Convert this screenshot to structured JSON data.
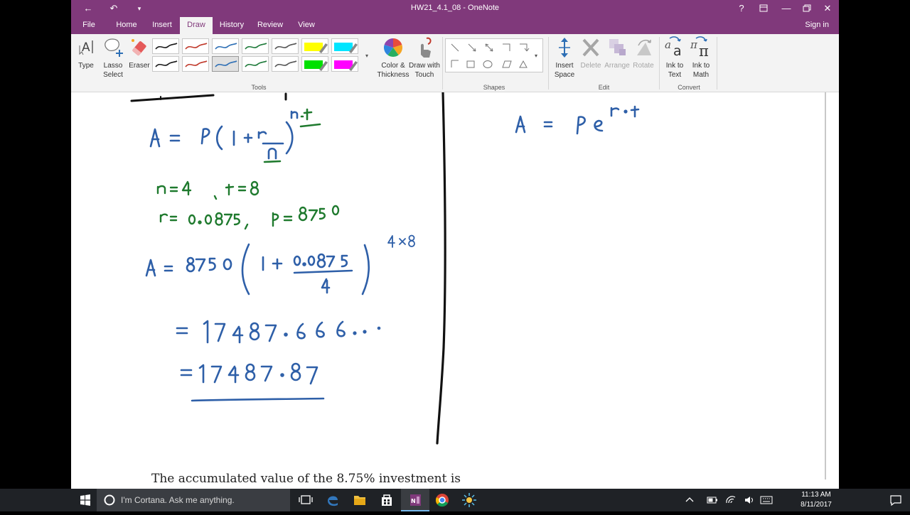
{
  "window": {
    "title": "HW21_4.1_08 - OneNote",
    "help": "?",
    "back_glyph": "←",
    "undo_glyph": "↶",
    "qat_glyph": "▾",
    "minimize_glyph": "—",
    "close_glyph": "✕"
  },
  "tabs": [
    {
      "label": "File"
    },
    {
      "label": "Home"
    },
    {
      "label": "Insert"
    },
    {
      "label": "Draw"
    },
    {
      "label": "History"
    },
    {
      "label": "Review"
    },
    {
      "label": "View"
    }
  ],
  "signin": "Sign in",
  "ribbon": {
    "type_label": "Type",
    "lasso_label": "Lasso Select",
    "eraser_label": "Eraser",
    "tools_group": "Tools",
    "color_label": "Color & Thickness",
    "draw_touch_label": "Draw with Touch",
    "shapes_group": "Shapes",
    "insert_space_label": "Insert Space",
    "delete_label": "Delete",
    "arrange_label": "Arrange",
    "rotate_label": "Rotate",
    "edit_group": "Edit",
    "ink_text_label": "Ink to Text",
    "ink_math_label": "Ink to Math",
    "convert_group": "Convert",
    "pens": [
      {
        "color": "#1a1a1a",
        "kind": "pen"
      },
      {
        "color": "#c0392b",
        "kind": "pen"
      },
      {
        "color": "#2e6fb5",
        "kind": "pen"
      },
      {
        "color": "#1e7a3a",
        "kind": "pen"
      },
      {
        "color": "#555555",
        "kind": "pen"
      },
      {
        "color": "#ffff00",
        "kind": "highlighter"
      },
      {
        "color": "#00e5ff",
        "kind": "highlighter"
      },
      {
        "color": "#1a1a1a",
        "kind": "pen"
      },
      {
        "color": "#c0392b",
        "kind": "pen"
      },
      {
        "color": "#2e6fb5",
        "kind": "pen"
      },
      {
        "color": "#1e7a3a",
        "kind": "pen"
      },
      {
        "color": "#555555",
        "kind": "pen"
      },
      {
        "color": "#00e000",
        "kind": "highlighter"
      },
      {
        "color": "#ff00ff",
        "kind": "highlighter"
      }
    ],
    "icons": [
      "type-icon",
      "lasso-icon",
      "eraser-icon",
      "color-wheel-icon",
      "touch-draw-icon",
      "insert-space-icon",
      "delete-icon",
      "arrange-icon",
      "rotate-icon",
      "ink-to-text-icon",
      "ink-to-math-icon"
    ]
  },
  "page": {
    "bottom_text": "The accumulated value of the 8.75% investment is"
  },
  "taskbar": {
    "cortana_placeholder": "I'm Cortana. Ask me anything.",
    "time": "11:13 AM",
    "date": "8/11/2017"
  },
  "colors": {
    "accent": "#80397b",
    "ink_blue": "#2e5fa8",
    "ink_green": "#1f7a2e",
    "ink_black": "#111111"
  }
}
